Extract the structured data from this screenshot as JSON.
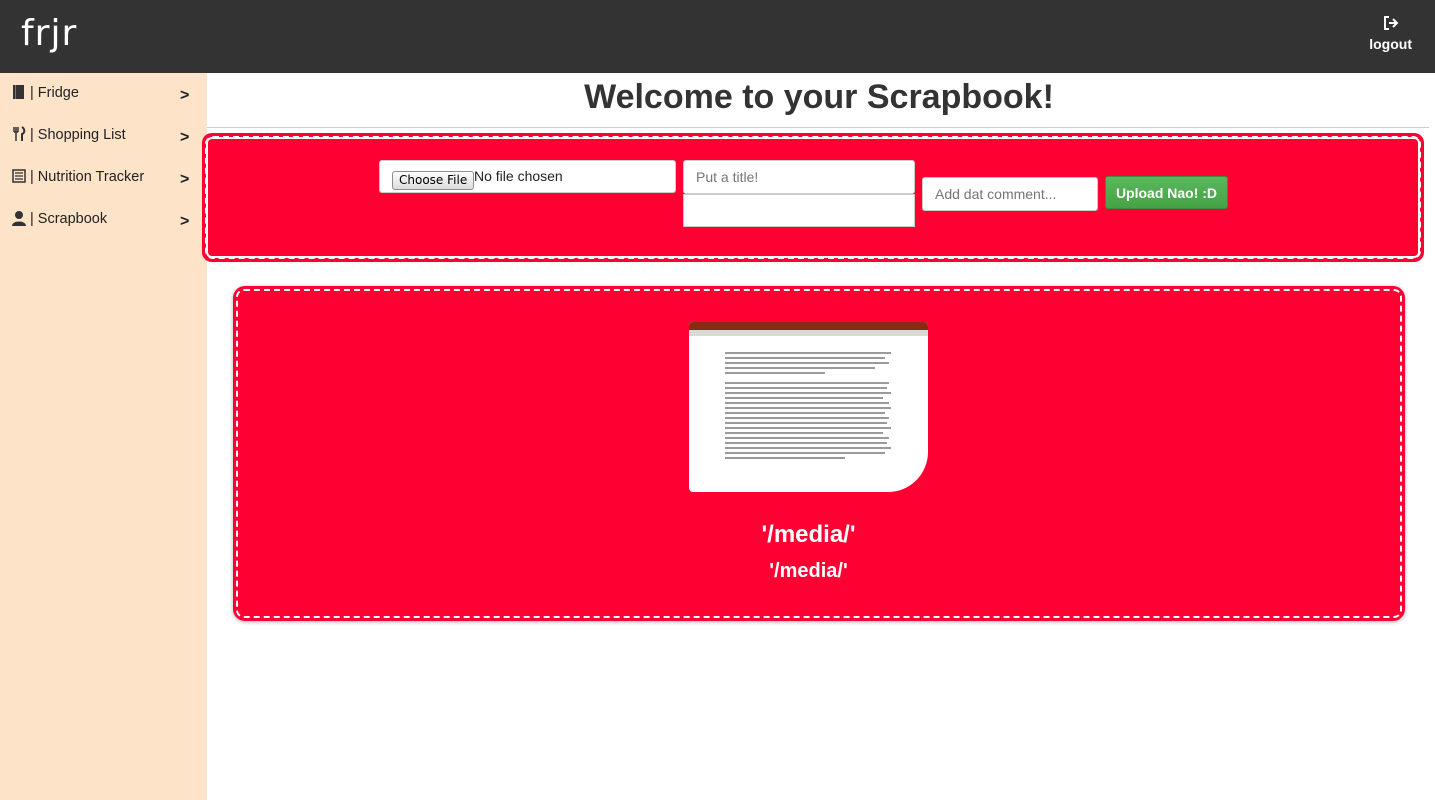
{
  "topbar": {
    "logo": "frjr",
    "logout_label": "logout",
    "logout_icon": "sign-out-icon",
    "background": "#333333"
  },
  "sidebar": {
    "background": "#fde3c7",
    "items": [
      {
        "label": "| Fridge",
        "icon": "book-icon",
        "chevron": ">"
      },
      {
        "label": "| Shopping List",
        "icon": "cutlery-icon",
        "chevron": ">"
      },
      {
        "label": "| Nutrition Tracker",
        "icon": "list-icon",
        "chevron": ">"
      },
      {
        "label": "| Scrapbook",
        "icon": "user-icon",
        "chevron": ">"
      }
    ]
  },
  "main": {
    "title": "Welcome to your Scrapbook!",
    "upload_form": {
      "file_button_label": "Choose File",
      "file_status": "No file chosen",
      "title_placeholder": "Put a title!",
      "comment_placeholder": "Add dat comment...",
      "submit_label": "Upload Nao! :D"
    },
    "post": {
      "title": "'/media/'",
      "caption": "'/media/'"
    }
  },
  "colors": {
    "panel_red": "#ff0033",
    "button_green": "#5bb75b"
  }
}
